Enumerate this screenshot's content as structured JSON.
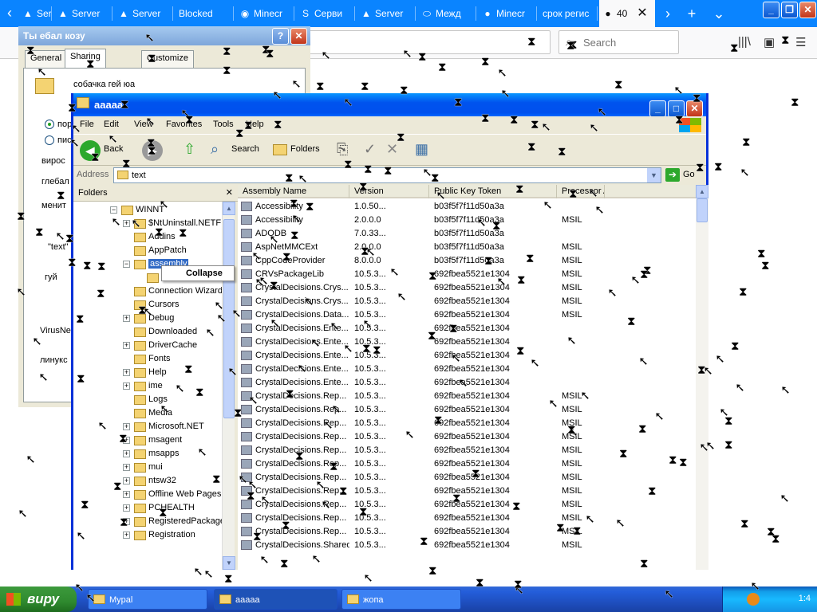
{
  "browser": {
    "tabs": [
      {
        "label": "Server",
        "icon": "warning-icon"
      },
      {
        "label": "Server",
        "icon": "warning-icon"
      },
      {
        "label": "Server",
        "icon": "warning-icon"
      },
      {
        "label": "Blocked",
        "icon": ""
      },
      {
        "label": "Minecr",
        "icon": "mod-icon"
      },
      {
        "label": "Серви",
        "icon": "s-icon"
      },
      {
        "label": "Server",
        "icon": "warning-icon"
      },
      {
        "label": "Межд",
        "icon": "ellipse-icon"
      },
      {
        "label": "Minecr",
        "icon": "dot-icon"
      },
      {
        "label": "срок регис",
        "icon": ""
      },
      {
        "label": "40",
        "icon": "dot-icon"
      }
    ],
    "search_placeholder": "Search",
    "accent": "#0a84ff"
  },
  "props_dialog": {
    "title": "Ты ебал козу",
    "tabs": [
      "General",
      "Sharing",
      "Customize"
    ],
    "folder_name": "собачка гей юа",
    "radio1": "пор",
    "radio2": "пис",
    "text_lines": [
      "вирос",
      "глебал",
      "менит",
      "\"text\"",
      "гуй",
      "VirusNe",
      "линукс"
    ]
  },
  "explorer": {
    "title": "aaaaa",
    "menu": [
      "File",
      "Edit",
      "View",
      "Favorites",
      "Tools",
      "Help"
    ],
    "toolbar": {
      "back": "Back",
      "search": "Search",
      "folders": "Folders"
    },
    "address_label": "Address",
    "address_value": "text",
    "go_label": "Go",
    "folders_header": "Folders",
    "tree": [
      {
        "label": "WINNT",
        "exp": "−",
        "indent": 0
      },
      {
        "label": "$NtUninstall.NETF",
        "exp": "+",
        "indent": 1
      },
      {
        "label": "Addins",
        "exp": "",
        "indent": 1
      },
      {
        "label": "AppPatch",
        "exp": "",
        "indent": 1
      },
      {
        "label": "assembly",
        "exp": "−",
        "indent": 1,
        "selected": true
      },
      {
        "label": "",
        "exp": "",
        "indent": 2
      },
      {
        "label": "Connection Wizard",
        "exp": "",
        "indent": 1
      },
      {
        "label": "Cursors",
        "exp": "",
        "indent": 1
      },
      {
        "label": "Debug",
        "exp": "+",
        "indent": 1
      },
      {
        "label": "Downloaded",
        "exp": "",
        "indent": 1
      },
      {
        "label": "DriverCache",
        "exp": "+",
        "indent": 1
      },
      {
        "label": "Fonts",
        "exp": "",
        "indent": 1
      },
      {
        "label": "Help",
        "exp": "+",
        "indent": 1
      },
      {
        "label": "ime",
        "exp": "+",
        "indent": 1
      },
      {
        "label": "Logs",
        "exp": "",
        "indent": 1
      },
      {
        "label": "Media",
        "exp": "",
        "indent": 1
      },
      {
        "label": "Microsoft.NET",
        "exp": "+",
        "indent": 1
      },
      {
        "label": "msagent",
        "exp": "+",
        "indent": 1
      },
      {
        "label": "msapps",
        "exp": "+",
        "indent": 1
      },
      {
        "label": "mui",
        "exp": "+",
        "indent": 1
      },
      {
        "label": "ntsw32",
        "exp": "+",
        "indent": 1
      },
      {
        "label": "Offline Web Pages",
        "exp": "+",
        "indent": 1
      },
      {
        "label": "PCHEALTH",
        "exp": "+",
        "indent": 1
      },
      {
        "label": "RegisteredPackages",
        "exp": "+",
        "indent": 1
      },
      {
        "label": "Registration",
        "exp": "+",
        "indent": 1
      }
    ],
    "context_label": "Collapse",
    "columns": [
      "Assembly Name",
      "Version",
      "Public Key Token",
      "Processor Architecture"
    ],
    "rows": [
      [
        "Accessibility",
        "1.0.50...",
        "b03f5f7f11d50a3a",
        ""
      ],
      [
        "Accessibility",
        "2.0.0.0",
        "b03f5f7f11d50a3a",
        "MSIL"
      ],
      [
        "ADODB",
        "7.0.33...",
        "b03f5f7f11d50a3a",
        ""
      ],
      [
        "AspNetMMCExt",
        "2.0.0.0",
        "b03f5f7f11d50a3a",
        "MSIL"
      ],
      [
        "CppCodeProvider",
        "8.0.0.0",
        "b03f5f7f11d50a3a",
        "MSIL"
      ],
      [
        "CRVsPackageLib",
        "10.5.3...",
        "692fbea5521e1304",
        "MSIL"
      ],
      [
        "CrystalDecisions.Crys...",
        "10.5.3...",
        "692fbea5521e1304",
        "MSIL"
      ],
      [
        "CrystalDecisions.Crys...",
        "10.5.3...",
        "692fbea5521e1304",
        "MSIL"
      ],
      [
        "CrystalDecisions.Data...",
        "10.5.3...",
        "692fbea5521e1304",
        "MSIL"
      ],
      [
        "CrystalDecisions.Ente...",
        "10.5.3...",
        "692fbea5521e1304",
        ""
      ],
      [
        "CrystalDecisions.Ente...",
        "10.5.3...",
        "692fbea5521e1304",
        ""
      ],
      [
        "CrystalDecisions.Ente...",
        "10.5.3...",
        "692fbea5521e1304",
        ""
      ],
      [
        "CrystalDecisions.Ente...",
        "10.5.3...",
        "692fbea5521e1304",
        ""
      ],
      [
        "CrystalDecisions.Ente...",
        "10.5.3...",
        "692fbea5521e1304",
        ""
      ],
      [
        "CrystalDecisions.Rep...",
        "10.5.3...",
        "692fbea5521e1304",
        "MSIL"
      ],
      [
        "CrystalDecisions.Rep...",
        "10.5.3...",
        "692fbea5521e1304",
        "MSIL"
      ],
      [
        "CrystalDecisions.Rep...",
        "10.5.3...",
        "692fbea5521e1304",
        "MSIL"
      ],
      [
        "CrystalDecisions.Rep...",
        "10.5.3...",
        "692fbea5521e1304",
        "MSIL"
      ],
      [
        "CrystalDecisions.Rep...",
        "10.5.3...",
        "692fbea5521e1304",
        "MSIL"
      ],
      [
        "CrystalDecisions.Rep...",
        "10.5.3...",
        "692fbea5521e1304",
        "MSIL"
      ],
      [
        "CrystalDecisions.Rep...",
        "10.5.3...",
        "692fbea5521e1304",
        "MSIL"
      ],
      [
        "CrystalDecisions.Rep...",
        "10.5.3...",
        "692fbea5521e1304",
        "MSIL"
      ],
      [
        "CrystalDecisions.Rep...",
        "10.5.3...",
        "692fbea5521e1304",
        "MSIL"
      ],
      [
        "CrystalDecisions.Rep...",
        "10.5.3...",
        "692fbea5521e1304",
        "MSIL"
      ],
      [
        "CrystalDecisions.Rep...",
        "10.5.3...",
        "692fbea5521e1304",
        "MSIL"
      ],
      [
        "CrystalDecisions.Shared",
        "10.5.3...",
        "692fbea5521e1304",
        "MSIL"
      ]
    ]
  },
  "taskbar": {
    "start_label": "виру",
    "tasks": [
      {
        "label": "Mypal"
      },
      {
        "label": "aaaaa"
      },
      {
        "label": "жопа"
      }
    ],
    "clock": "1:4"
  }
}
